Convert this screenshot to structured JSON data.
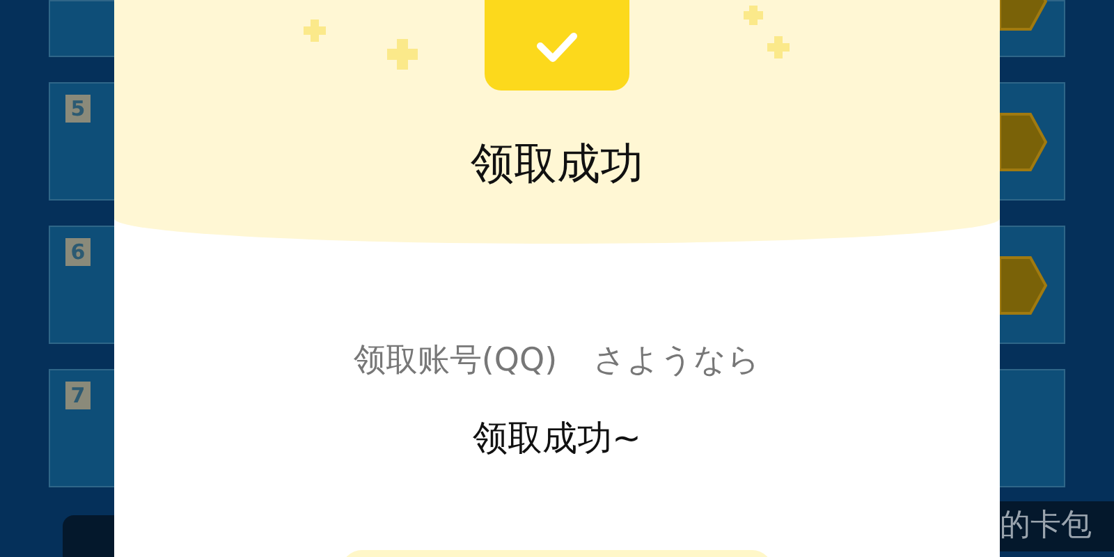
{
  "background": {
    "left_cards": [
      {
        "kind": "cut"
      },
      {
        "kind": "numbered",
        "number": "5"
      },
      {
        "kind": "numbered",
        "number": "6"
      },
      {
        "kind": "numbered",
        "number": "7"
      }
    ],
    "right_cards": [
      {
        "kind": "hex"
      },
      {
        "kind": "hex"
      },
      {
        "kind": "hex"
      },
      {
        "kind": "plain"
      }
    ],
    "right_label": "的卡包"
  },
  "dialog": {
    "title": "领取成功",
    "account_label": "领取账号(QQ)",
    "account_name": "さようなら",
    "message": "领取成功~"
  }
}
